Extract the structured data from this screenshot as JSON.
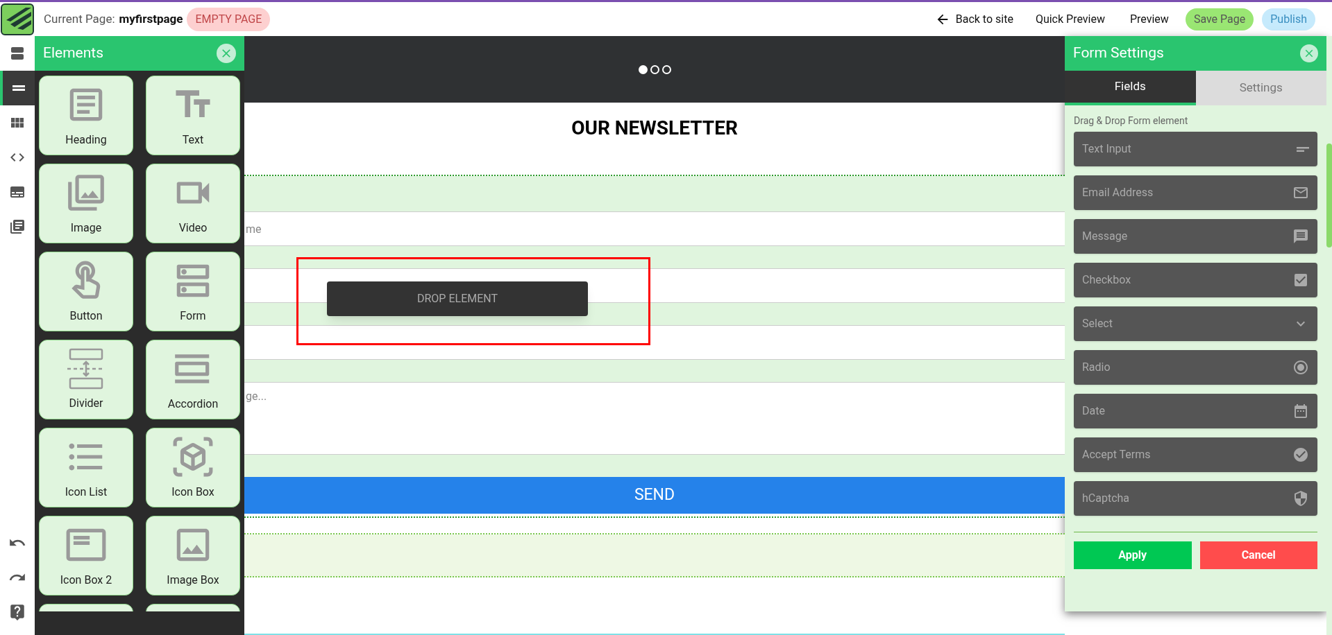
{
  "topbar": {
    "current_page_label": "Current Page:",
    "current_page_name": "myfirstpage",
    "status_badge": "EMPTY PAGE",
    "back_link": "Back to site",
    "actions": [
      {
        "kind": "link",
        "label": "Quick Preview"
      },
      {
        "kind": "link",
        "label": "Preview"
      },
      {
        "kind": "save",
        "label": "Save Page"
      },
      {
        "kind": "publish",
        "label": "Publish"
      }
    ]
  },
  "rail": {
    "top_items": [
      {
        "kind": "rows",
        "selected": false
      },
      {
        "kind": "section",
        "selected": true
      },
      {
        "kind": "grid",
        "selected": false
      },
      {
        "kind": "code",
        "selected": false
      },
      {
        "kind": "captions",
        "selected": false
      },
      {
        "kind": "library",
        "selected": false
      }
    ],
    "bottom_items": [
      {
        "kind": "undo"
      },
      {
        "kind": "redo"
      },
      {
        "kind": "help"
      }
    ]
  },
  "elements_panel": {
    "title": "Elements",
    "tiles": [
      {
        "kind": "heading",
        "label": "Heading"
      },
      {
        "kind": "text",
        "label": "Text"
      },
      {
        "kind": "image",
        "label": "Image"
      },
      {
        "kind": "video",
        "label": "Video"
      },
      {
        "kind": "button",
        "label": "Button"
      },
      {
        "kind": "form",
        "label": "Form"
      },
      {
        "kind": "divider",
        "label": "Divider"
      },
      {
        "kind": "accordion",
        "label": "Accordion"
      },
      {
        "kind": "icon_list",
        "label": "Icon List"
      },
      {
        "kind": "icon_box",
        "label": "Icon Box"
      },
      {
        "kind": "icon_box_2",
        "label": "Icon Box 2"
      },
      {
        "kind": "image_box",
        "label": "Image Box"
      },
      {
        "kind": "cut"
      },
      {
        "kind": "cut"
      }
    ]
  },
  "canvas": {
    "carousel_dots": [
      {
        "selected": true
      },
      {
        "selected": false
      },
      {
        "selected": false
      }
    ],
    "heading": "OUR NEWSLETTER",
    "form_fields": [
      {
        "kind": "input",
        "placeholder": "me"
      },
      {
        "kind": "input"
      },
      {
        "kind": "input"
      },
      {
        "kind": "textarea",
        "placeholder": "ge..."
      }
    ],
    "submit_button": "SEND",
    "drop_hint": "DROP ELEMENT"
  },
  "form_settings": {
    "title": "Form Settings",
    "tabs": [
      {
        "label": "Fields",
        "selected": true
      },
      {
        "label": "Settings",
        "selected": false
      }
    ],
    "hint": "Drag & Drop Form element",
    "fields": [
      {
        "kind": "text",
        "label": "Text Input"
      },
      {
        "kind": "email",
        "label": "Email Address"
      },
      {
        "kind": "message",
        "label": "Message"
      },
      {
        "kind": "checkbox",
        "label": "Checkbox"
      },
      {
        "kind": "select",
        "label": "Select"
      },
      {
        "kind": "radio",
        "label": "Radio"
      },
      {
        "kind": "date",
        "label": "Date"
      },
      {
        "kind": "terms",
        "label": "Accept Terms"
      },
      {
        "kind": "captcha",
        "label": "hCaptcha"
      }
    ],
    "buttons": [
      {
        "kind": "apply",
        "label": "Apply"
      },
      {
        "kind": "cancel",
        "label": "Cancel"
      }
    ]
  }
}
